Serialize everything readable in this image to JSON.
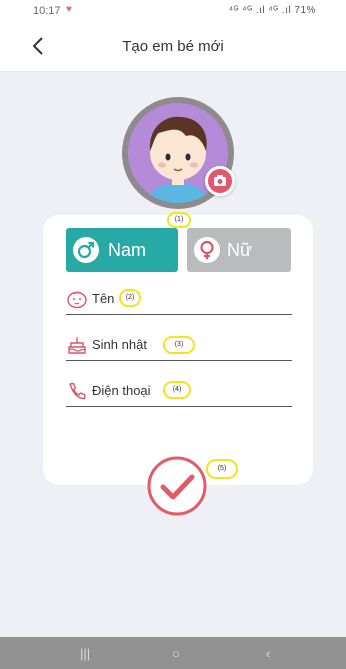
{
  "status_bar": {
    "time": "10:17",
    "signal_text": "⁴ᴳ ⁴ᴳ .ıl ⁴ᴳ .ıl 71%"
  },
  "header": {
    "title": "Tạo em bé mới"
  },
  "markers": {
    "m1": "(1)",
    "m2": "(2)",
    "m3": "(3)",
    "m4": "(4)",
    "m5": "(5)"
  },
  "gender": {
    "male_label": "Nam",
    "female_label": "Nữ"
  },
  "fields": {
    "name_label": "Tên",
    "birthday_label": "Sinh nhật",
    "phone_label": "Điện thoại"
  },
  "colors": {
    "male_button": "#27a9a5",
    "female_button": "#b9bbbd",
    "confirm": "#e45a66",
    "icon_red": "#d9566a",
    "background": "#eef0f5"
  }
}
